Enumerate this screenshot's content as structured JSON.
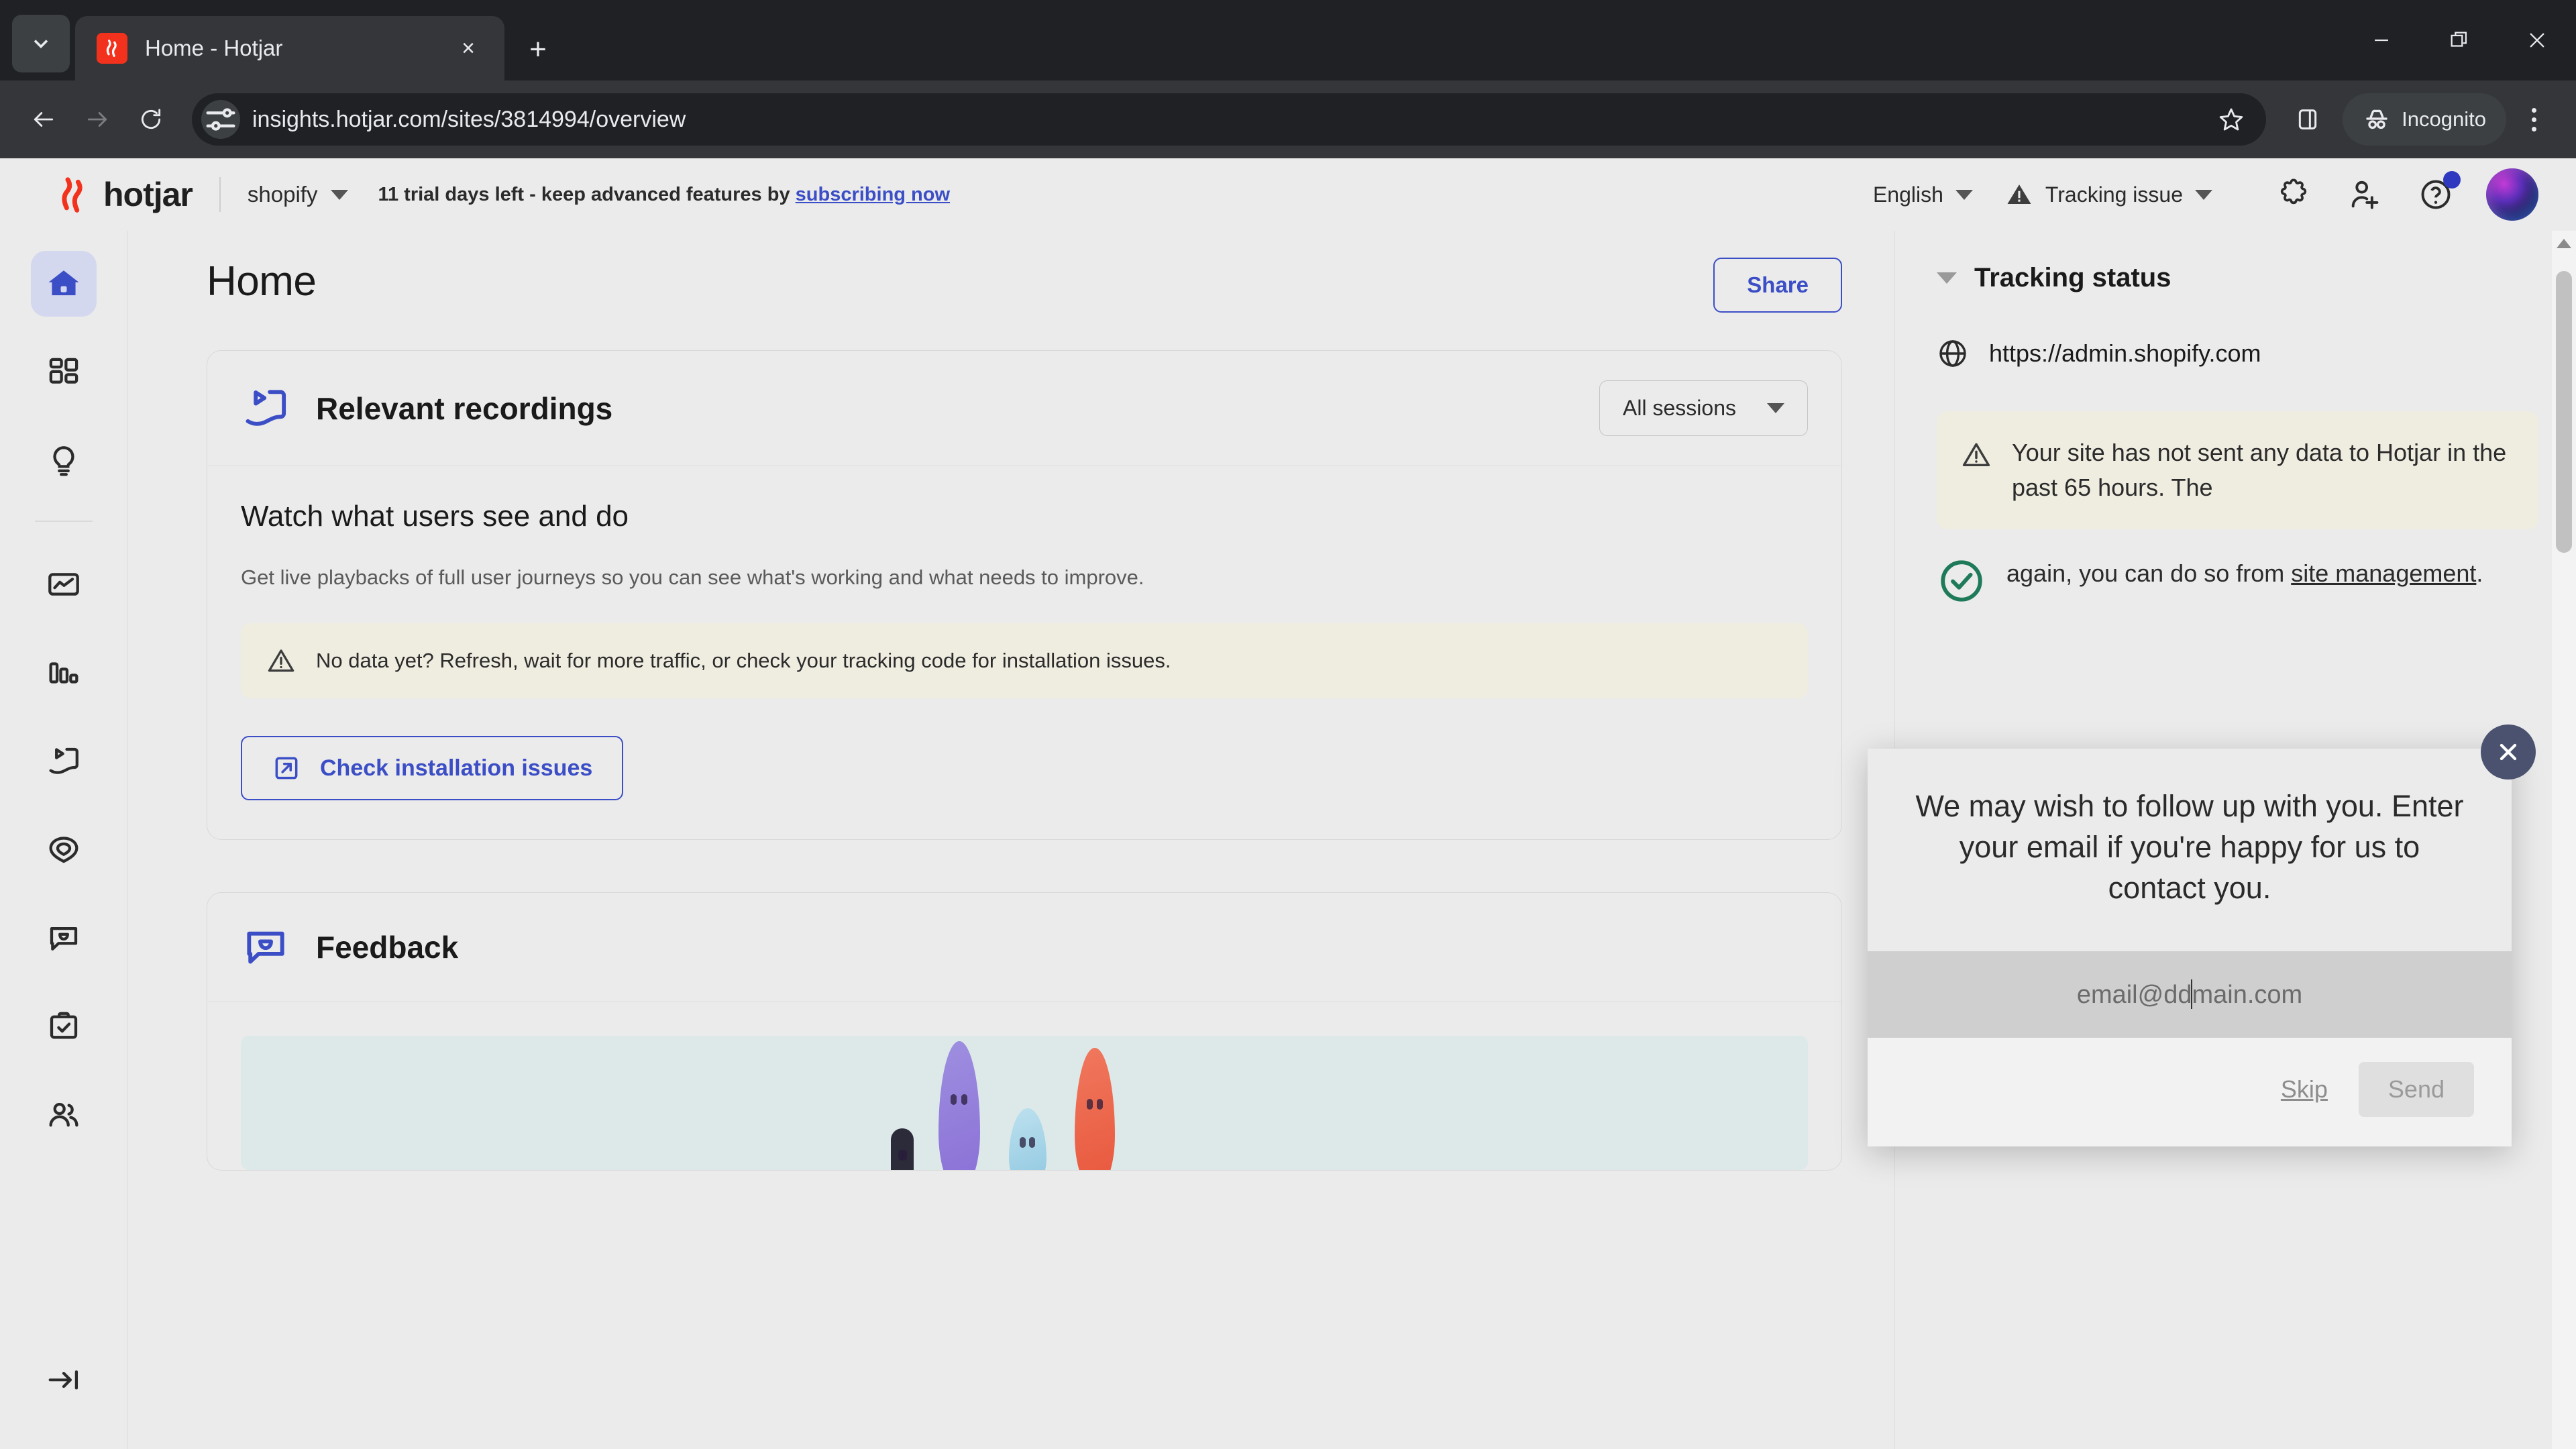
{
  "browser": {
    "tab": {
      "title": "Home - Hotjar",
      "favicon": "hotjar-flame-icon"
    },
    "tab_search_icon": "chevron-down-icon",
    "new_tab_label": "+",
    "close_tab_label": "×",
    "window": {
      "minimize": "minimize-icon",
      "maximize": "restore-icon",
      "close": "close-icon"
    },
    "nav": {
      "back": "back-arrow-icon",
      "forward": "forward-arrow-icon",
      "reload": "reload-icon"
    },
    "omnibox": {
      "site_info_icon": "tune-site-settings-icon",
      "url": "insights.hotjar.com/sites/3814994/overview"
    },
    "actions": {
      "bookmark_icon": "star-icon",
      "sidepanel_icon": "side-panel-icon",
      "incognito_label": "Incognito",
      "incognito_icon": "incognito-hat-icon",
      "menu_icon": "three-dots-icon"
    }
  },
  "app_header": {
    "logo_text": "hotjar",
    "site_name": "shopify",
    "trial_text": "11 trial days left - keep advanced features by ",
    "trial_link": "subscribing now",
    "language": "English",
    "tracking_issue": "Tracking issue",
    "icons": {
      "integrations": "puzzle-piece-icon",
      "invite_user": "add-user-icon",
      "help": "question-mark-icon",
      "avatar": "user-avatar"
    }
  },
  "sidebar": {
    "items": [
      {
        "name": "home",
        "icon": "home-icon",
        "active": true
      },
      {
        "name": "dashboards",
        "icon": "grid-icon",
        "active": false
      },
      {
        "name": "insights",
        "icon": "lightbulb-icon",
        "active": false
      },
      {
        "name": "trends",
        "icon": "trend-chart-icon",
        "active": false
      },
      {
        "name": "funnels",
        "icon": "bar-chart-icon",
        "active": false
      },
      {
        "name": "recordings",
        "icon": "recordings-icon",
        "active": false
      },
      {
        "name": "heatmaps",
        "icon": "heatmap-icon",
        "active": false
      },
      {
        "name": "feedback",
        "icon": "speech-bubble-icon",
        "active": false
      },
      {
        "name": "surveys",
        "icon": "clipboard-check-icon",
        "active": false
      },
      {
        "name": "users",
        "icon": "people-icon",
        "active": false
      }
    ],
    "collapse": {
      "name": "collapse",
      "icon": "collapse-arrow-icon"
    }
  },
  "main": {
    "page_title": "Home",
    "share_button": "Share",
    "recordings_card": {
      "icon": "recordings-icon",
      "title": "Relevant recordings",
      "filter_value": "All sessions",
      "heading": "Watch what users see and do",
      "description": "Get live playbacks of full user journeys so you can see what's working and what needs to improve.",
      "warning": "No data yet? Refresh, wait for more traffic, or check your tracking code for installation issues.",
      "warning_icon": "warning-triangle-icon",
      "cta_label": "Check installation issues",
      "cta_icon": "external-link-icon"
    },
    "feedback_card": {
      "icon": "speech-bubble-icon",
      "title": "Feedback"
    }
  },
  "right_panel": {
    "section_title": "Tracking status",
    "collapse_icon": "caret-down-icon",
    "site_url": "https://admin.shopify.com",
    "globe_icon": "globe-icon",
    "warning_icon": "warning-triangle-icon",
    "warning_text": "Your site has not sent any data to Hotjar in the past 65 hours. The",
    "ok_icon": "check-circle-icon",
    "ok_text_tail": "again, you can do so from ",
    "ok_link": "site management",
    "ok_text_end": "."
  },
  "survey_modal": {
    "close_icon": "close-icon",
    "question": "We may wish to follow up with you. Enter your email if you're happy for us to contact you.",
    "email_value": "email@domain.com",
    "email_placeholder": "email@domain.com",
    "skip_label": "Skip",
    "send_label": "Send"
  },
  "colors": {
    "brand_red": "#f2321d",
    "accent_blue": "#3b4ec6",
    "warning_bg": "#efece0",
    "page_bg": "#ebebeb",
    "chrome_bg": "#202124"
  }
}
